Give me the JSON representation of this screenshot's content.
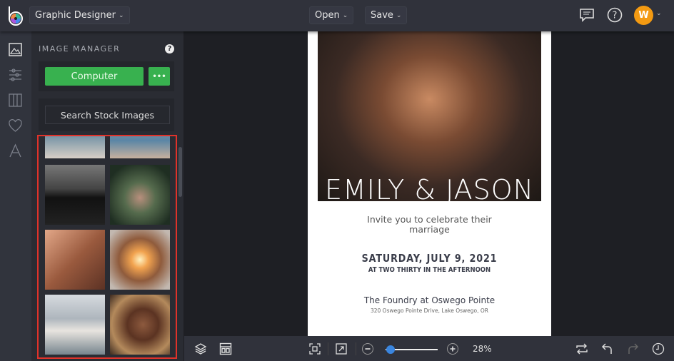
{
  "header": {
    "app_menu": "Graphic Designer",
    "open": "Open",
    "save": "Save",
    "avatar_initial": "W"
  },
  "panel": {
    "title": "IMAGE MANAGER",
    "help": "?",
    "computer": "Computer",
    "more": "•••",
    "search_stock": "Search Stock Images"
  },
  "canvas": {
    "names": "EMILY & JASON",
    "invite": "Invite you to celebrate their",
    "invite2": "marriage",
    "date": "SATURDAY, JULY 9, 2021",
    "time": "AT TWO THIRTY IN THE AFTERNOON",
    "venue": "The Foundry at Oswego Pointe",
    "address": "320 Oswego Pointe Drive, Lake Oswego, OR"
  },
  "toolbar": {
    "zoom": "28%",
    "zoom_fraction": 0.1
  },
  "colors": {
    "accent": "#38b14f",
    "avatar": "#f39a12",
    "highlight": "#e0322a",
    "slider": "#3a86e0"
  }
}
